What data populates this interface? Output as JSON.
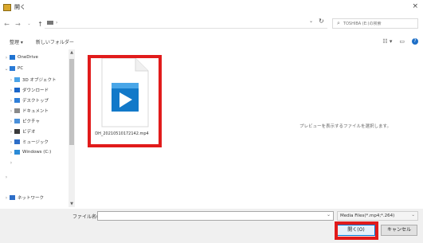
{
  "window": {
    "title": "開く"
  },
  "address": {
    "path_separator": "›"
  },
  "search": {
    "placeholder": "TOSHIBA (E:)の検索"
  },
  "toolbar": {
    "organize": "整理 ▾",
    "new_folder": "新しいフォルダー"
  },
  "nav": {
    "items": [
      {
        "label": "OneDrive",
        "icon": "onedrive-icon",
        "color": "#1f73d1",
        "chev": "›"
      },
      {
        "label": "PC",
        "icon": "pc-icon",
        "color": "#2a7ad6",
        "chev": "⌄"
      },
      {
        "label": "3D オブジェクト",
        "icon": "3d-objects-icon",
        "color": "#4aa3e8",
        "chev": "›"
      },
      {
        "label": "ダウンロード",
        "icon": "download-icon",
        "color": "#1a66c9",
        "chev": "›"
      },
      {
        "label": "デスクトップ",
        "icon": "desktop-icon",
        "color": "#2f7fd8",
        "chev": "›"
      },
      {
        "label": "ドキュメント",
        "icon": "documents-icon",
        "color": "#8a8a8a",
        "chev": "›"
      },
      {
        "label": "ピクチャ",
        "icon": "pictures-icon",
        "color": "#4a8fd9",
        "chev": "›"
      },
      {
        "label": "ビデオ",
        "icon": "videos-icon",
        "color": "#3a3a3a",
        "chev": "›"
      },
      {
        "label": "ミュージック",
        "icon": "music-icon",
        "color": "#2d6ec7",
        "chev": "›"
      },
      {
        "label": "Windows (C:)",
        "icon": "drive-icon",
        "color": "#2b8ad6",
        "chev": "›"
      },
      {
        "label": "",
        "icon": "",
        "color": "",
        "chev": "›"
      },
      {
        "label": "",
        "icon": "",
        "color": "",
        "chev": "›"
      },
      {
        "label": "ネットワーク",
        "icon": "network-icon",
        "color": "#2d6ec7",
        "chev": "›"
      }
    ]
  },
  "file": {
    "name": "DH_20210510172142.mp4"
  },
  "preview": {
    "message": "プレビューを表示するファイルを選択します。"
  },
  "footer": {
    "filename_label": "ファイル名(N):",
    "filename_value": "",
    "filter": "Media Files(*.mp4;*.264)",
    "open_label": "開く(O)",
    "cancel_label": "キャンセル"
  },
  "colors": {
    "highlight": "#e11b1b",
    "accent": "#0078d7"
  }
}
